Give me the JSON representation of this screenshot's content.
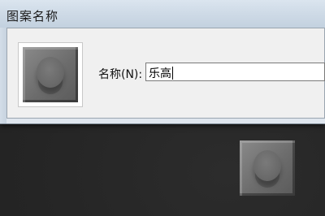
{
  "dialog": {
    "title": "图案名称",
    "name_label": "名称(N):",
    "name_value": "乐高"
  },
  "icons": {
    "preview": "lego-brick-pattern-icon",
    "desktop_tile": "lego-brick-pattern-icon"
  }
}
